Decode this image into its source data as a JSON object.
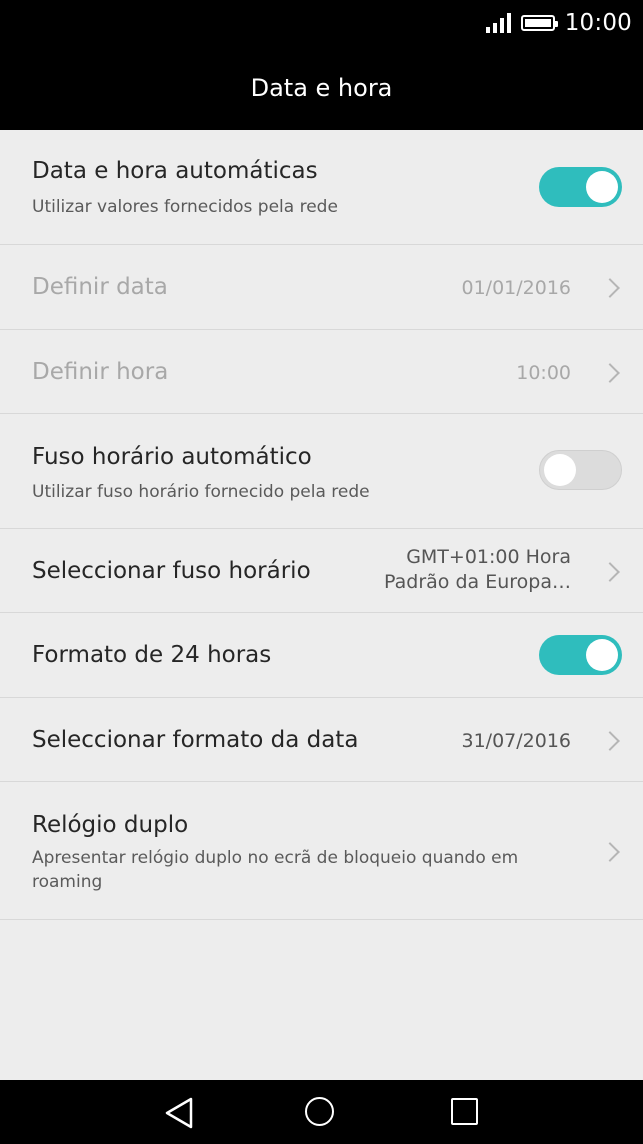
{
  "status_bar": {
    "time": "10:00",
    "signal_icon": "signal-bars-icon",
    "battery_icon": "battery-full-icon"
  },
  "header": {
    "title": "Data e hora"
  },
  "settings": {
    "auto_datetime": {
      "title": "Data e hora automáticas",
      "subtitle": "Utilizar valores fornecidos pela rede",
      "enabled": true
    },
    "set_date": {
      "title": "Definir data",
      "value": "01/01/2016"
    },
    "set_time": {
      "title": "Definir hora",
      "value": "10:00"
    },
    "auto_timezone": {
      "title": "Fuso horário automático",
      "subtitle": "Utilizar fuso horário fornecido pela rede",
      "enabled": false
    },
    "select_timezone": {
      "title": "Seleccionar fuso horário",
      "value_line1": "GMT+01:00 Hora",
      "value_line2": "Padrão da Europa…"
    },
    "format_24h": {
      "title": "Formato de 24 horas",
      "enabled": true
    },
    "date_format": {
      "title": "Seleccionar formato da data",
      "value": "31/07/2016"
    },
    "dual_clock": {
      "title": "Relógio duplo",
      "subtitle_line1": "Apresentar relógio duplo no ecrã de bloqueio quando em",
      "subtitle_line2": "roaming"
    }
  },
  "nav_bar": {
    "back_icon": "back-triangle-icon",
    "home_icon": "home-circle-icon",
    "recents_icon": "recents-square-icon"
  },
  "colors": {
    "accent": "#2fbdbd",
    "background": "#ededed",
    "bars": "#000000"
  }
}
